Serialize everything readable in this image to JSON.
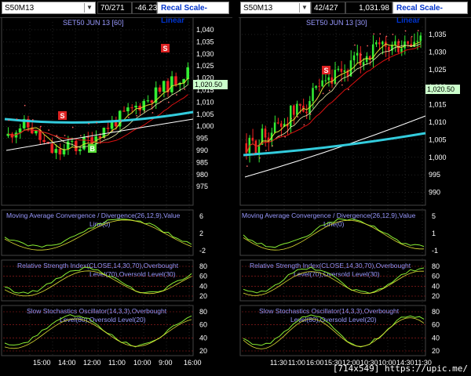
{
  "left": {
    "symbol": "S50M13",
    "volume": "70/271",
    "change": "-46.23",
    "recal_label": "Recal Scale-Linear",
    "chart_title": "SET50 JUN 13  [60]",
    "price_ticks": [
      "1,040",
      "1,035",
      "1,030",
      "1,025",
      "1,020",
      "1,015",
      "1,010",
      "1,005",
      "1,000",
      "995",
      "990",
      "985",
      "980",
      "975"
    ],
    "last_price": "1,020.50",
    "signals": [
      "S",
      "S",
      "B"
    ],
    "macd_title": "Moving Average Convergence / Divergence(26,12,9),Value",
    "macd_sub": "Line(0)",
    "macd_ticks": [
      "6",
      "2",
      "-2"
    ],
    "rsi_title": "Relative Strength Index(CLOSE,14,30,70),Overbought",
    "rsi_sub": "Level(70),Oversold Level(30)",
    "rsi_ticks": [
      "80",
      "60",
      "40",
      "20"
    ],
    "stoch_title": "Slow Stochastics Oscillator(14,3,3),Overbought",
    "stoch_sub": "Level(80),Oversold Level(20)",
    "stoch_ticks": [
      "80",
      "60",
      "40",
      "20"
    ],
    "time_ticks": [
      "15:00",
      "14:00",
      "12:00",
      "11:00",
      "10:00",
      "9:00",
      "16:00"
    ]
  },
  "right": {
    "symbol": "S50M13",
    "volume": "42/427",
    "change": "1,031.98",
    "recal_label": "Recal Scale-Linear",
    "chart_title": "SET50 JUN 13  [30]",
    "price_ticks": [
      "1,035",
      "1,030",
      "1,025",
      "1,020",
      "1,015",
      "1,010",
      "1,005",
      "1,000",
      "995",
      "990"
    ],
    "last_price": "1,020.50",
    "signals": [
      "S",
      "S"
    ],
    "macd_title": "Moving Average Convergence / Divergence(26,12,9),Value",
    "macd_sub": "Line(0)",
    "macd_ticks": [
      "5",
      "1",
      "-1"
    ],
    "rsi_title": "Relative Strength Index(CLOSE,14,30,70),Overbought",
    "rsi_sub": "Level(70),Oversold Level(30)",
    "rsi_ticks": [
      "80",
      "60",
      "40",
      "20"
    ],
    "stoch_title": "Slow Stochastics Oscillator(14,3,3),Overbought",
    "stoch_sub": "Level(80),Oversold Level(20)",
    "stoch_ticks": [
      "80",
      "60",
      "40",
      "20"
    ],
    "time_ticks": [
      "11:30",
      "11:00",
      "16:00",
      "15:30",
      "12:00",
      "10:30",
      "10:00",
      "14:30",
      "11:30"
    ]
  },
  "footer": "[714x549] https://upic.me/",
  "colors": {
    "up": "#33ee33",
    "down": "#ee2222",
    "ma_thick": "#33ccdd",
    "ma_white": "#ffffff",
    "ma_red": "#dd1111",
    "ma_yellow": "#dddd33",
    "grid": "#555555",
    "label": "#9999ff",
    "signal_sell": "#dd2222",
    "signal_buy": "#55dd33"
  }
}
